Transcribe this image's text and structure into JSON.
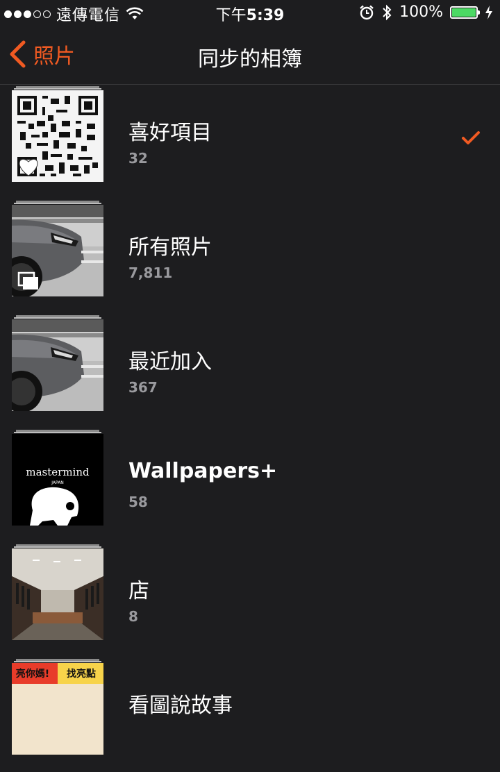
{
  "status_bar": {
    "signal_dots": [
      true,
      true,
      true,
      false,
      false
    ],
    "carrier": "遠傳電信",
    "time_prefix": "下午",
    "time": "5:39",
    "battery_percent": "100%",
    "battery_level": 1.0
  },
  "nav": {
    "back_label": "照片",
    "title": "同步的相簿"
  },
  "colors": {
    "accent": "#f05a22",
    "background": "#1d1d1f",
    "count_text": "#9a9a9e",
    "battery_fill": "#4cd964"
  },
  "albums": [
    {
      "name": "喜好項目",
      "count": "32",
      "thumb": "qr-code",
      "overlay_icon": "heart-icon",
      "selected": true
    },
    {
      "name": "所有照片",
      "count": "7,811",
      "thumb": "car-photo",
      "overlay_icon": "stack-icon",
      "selected": false
    },
    {
      "name": "最近加入",
      "count": "367",
      "thumb": "car-photo",
      "overlay_icon": "",
      "selected": false
    },
    {
      "name": "Wallpapers+",
      "count": "58",
      "thumb": "mastermind-skull",
      "thumb_text": "mastermind",
      "thumb_subtext": "JAPAN",
      "overlay_icon": "",
      "selected": false
    },
    {
      "name": "店",
      "count": "8",
      "thumb": "shop-interior",
      "overlay_icon": "",
      "selected": false
    },
    {
      "name": "看圖說故事",
      "count": "",
      "thumb": "comic-strip",
      "thumb_text": "亮你媽!",
      "thumb_subtext": "找亮點",
      "overlay_icon": "",
      "selected": false
    }
  ]
}
